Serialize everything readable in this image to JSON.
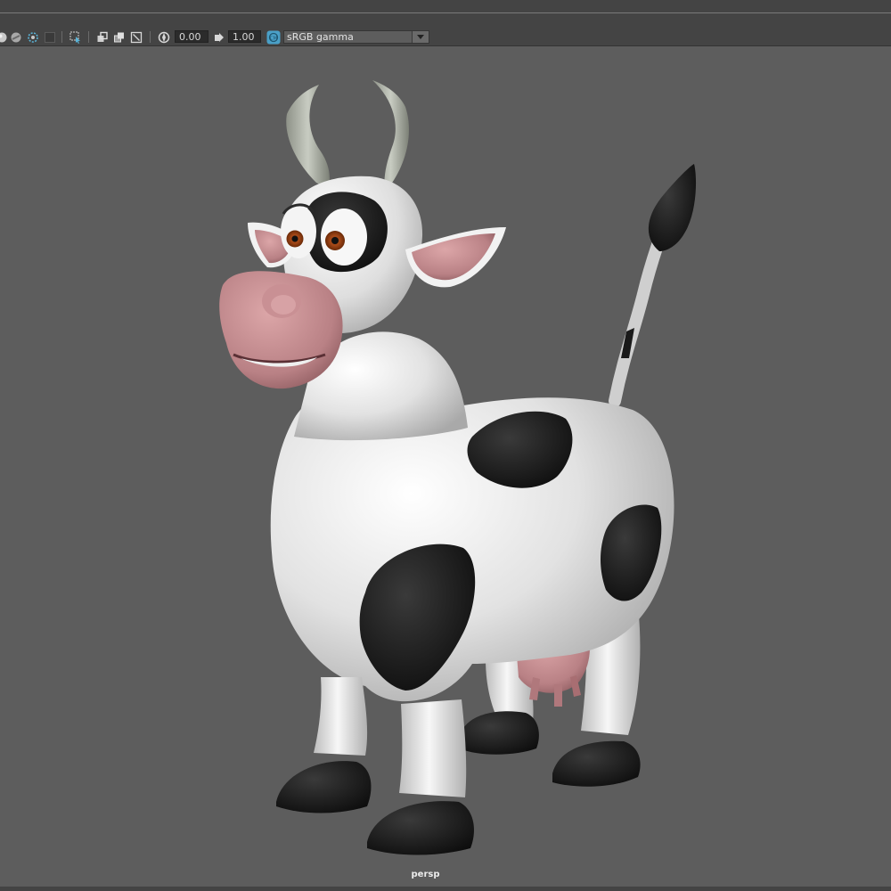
{
  "toolbar": {
    "icons": [
      "shading-sphere-icon",
      "textured-sphere-icon",
      "lighting-icon",
      "display-toggle-icon",
      "isolate-select-icon",
      "xray-icon",
      "wireframe-on-shaded-icon",
      "resolution-gate-icon",
      "exposure-icon",
      "gamma-icon",
      "color-management-icon"
    ],
    "exposure_value": "0.00",
    "gamma_value": "1.00",
    "color_space": "sRGB gamma"
  },
  "viewport": {
    "camera_label": "persp",
    "background_color": "#5d5d5d"
  }
}
